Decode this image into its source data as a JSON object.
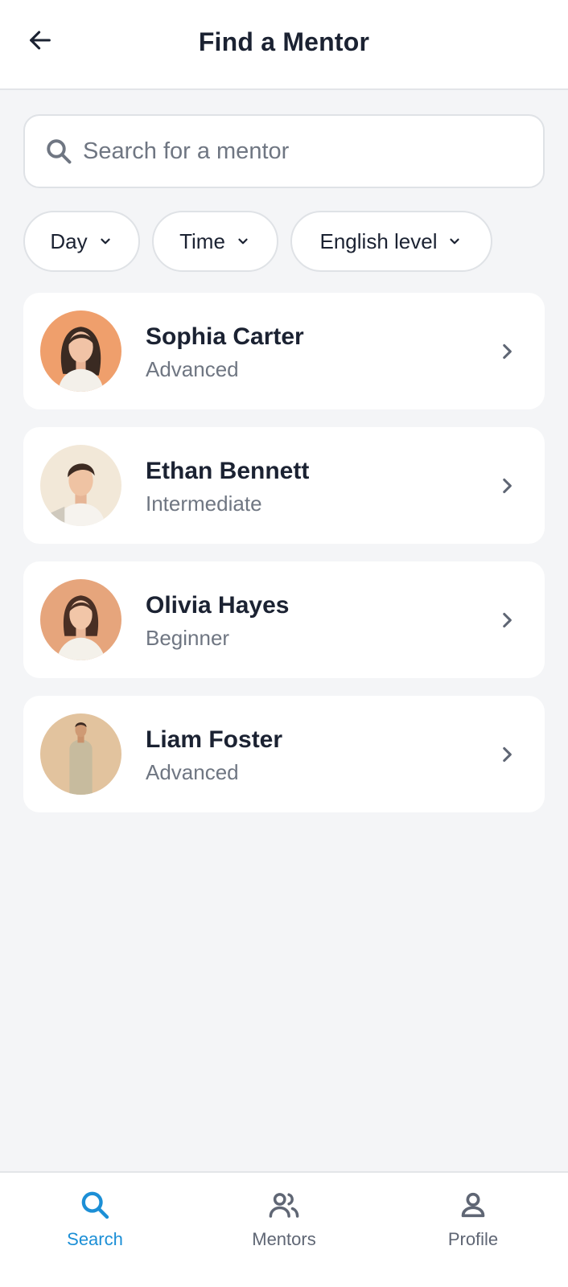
{
  "header": {
    "title": "Find a Mentor",
    "back_icon": "arrow-left-icon"
  },
  "search": {
    "placeholder": "Search for a mentor",
    "value": "",
    "icon": "search-icon"
  },
  "filters": [
    {
      "label": "Day",
      "icon": "chevron-down-icon"
    },
    {
      "label": "Time",
      "icon": "chevron-down-icon"
    },
    {
      "label": "English level",
      "icon": "chevron-down-icon"
    }
  ],
  "mentors": [
    {
      "name": "Sophia Carter",
      "level": "Advanced"
    },
    {
      "name": "Ethan Bennett",
      "level": "Intermediate"
    },
    {
      "name": "Olivia Hayes",
      "level": "Beginner"
    },
    {
      "name": "Liam Foster",
      "level": "Advanced"
    }
  ],
  "bottom_nav": [
    {
      "label": "Search",
      "icon": "search-icon",
      "active": true
    },
    {
      "label": "Mentors",
      "icon": "people-icon",
      "active": false
    },
    {
      "label": "Profile",
      "icon": "person-icon",
      "active": false
    }
  ],
  "colors": {
    "background": "#f4f5f7",
    "surface": "#ffffff",
    "text_primary": "#1b2232",
    "text_secondary": "#6f7682",
    "accent": "#1c8fd6",
    "nav_inactive": "#5f6674",
    "border": "#dfe2e6"
  }
}
